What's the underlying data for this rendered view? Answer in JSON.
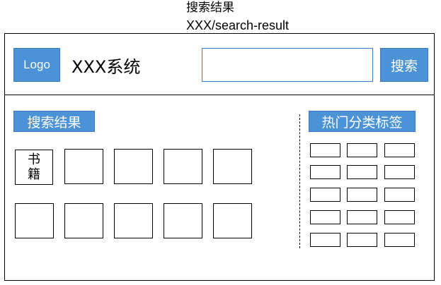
{
  "caption": {
    "title": "搜索结果",
    "url": "XXX/search-result"
  },
  "header": {
    "logo": "Logo",
    "system_title": "XXX系统",
    "search_value": "",
    "search_button": "搜索"
  },
  "results": {
    "label": "搜索结果",
    "first_item_lines": [
      "书",
      "籍"
    ]
  },
  "tags": {
    "label": "热门分类标签"
  },
  "colors": {
    "accent": "#4b93d6",
    "accent_border": "#3a7cc0"
  }
}
